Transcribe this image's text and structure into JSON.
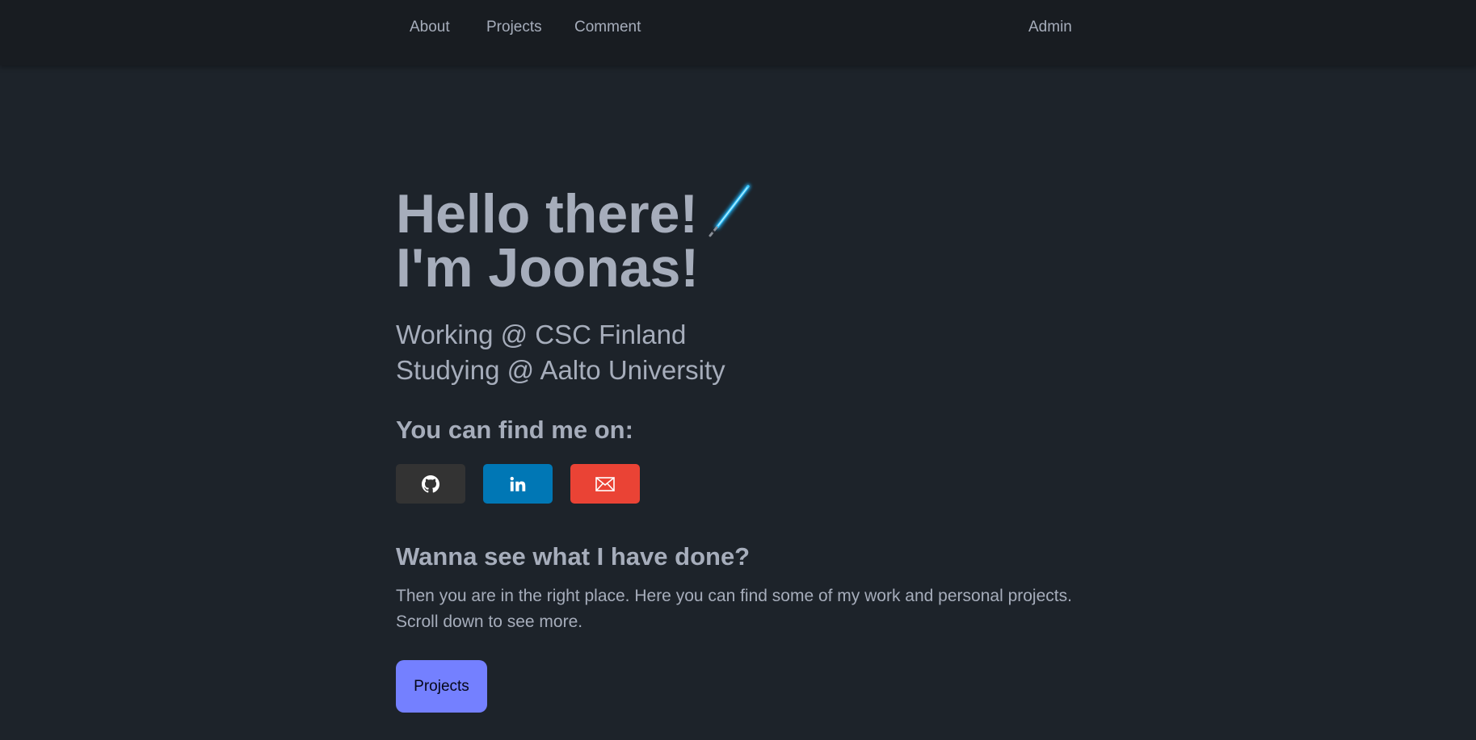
{
  "nav": {
    "about": "About",
    "projects": "Projects",
    "comment": "Comment",
    "admin": "Admin"
  },
  "hero": {
    "title_line1": "Hello there!",
    "title_line2": "I'm Joonas!",
    "title_icon": "lightsaber-icon",
    "subtitle_line1": "Working @ CSC Finland",
    "subtitle_line2": "Studying @ Aalto University"
  },
  "social": {
    "heading": "You can find me on:",
    "buttons": [
      {
        "icon": "github-icon",
        "color": "#333333"
      },
      {
        "icon": "linkedin-icon",
        "color": "#0077b5"
      },
      {
        "icon": "email-icon",
        "color": "#ea4335"
      }
    ]
  },
  "work": {
    "heading": "Wanna see what I have done?",
    "desc_line1": "Then you are in the right place. Here you can find some of my work and personal projects.",
    "desc_line2": "Scroll down to see more.",
    "button_label": "Projects"
  },
  "colors": {
    "background": "#1d232a",
    "navbar": "#181c21",
    "text": "#a6adbb",
    "primary": "#7480ff"
  }
}
